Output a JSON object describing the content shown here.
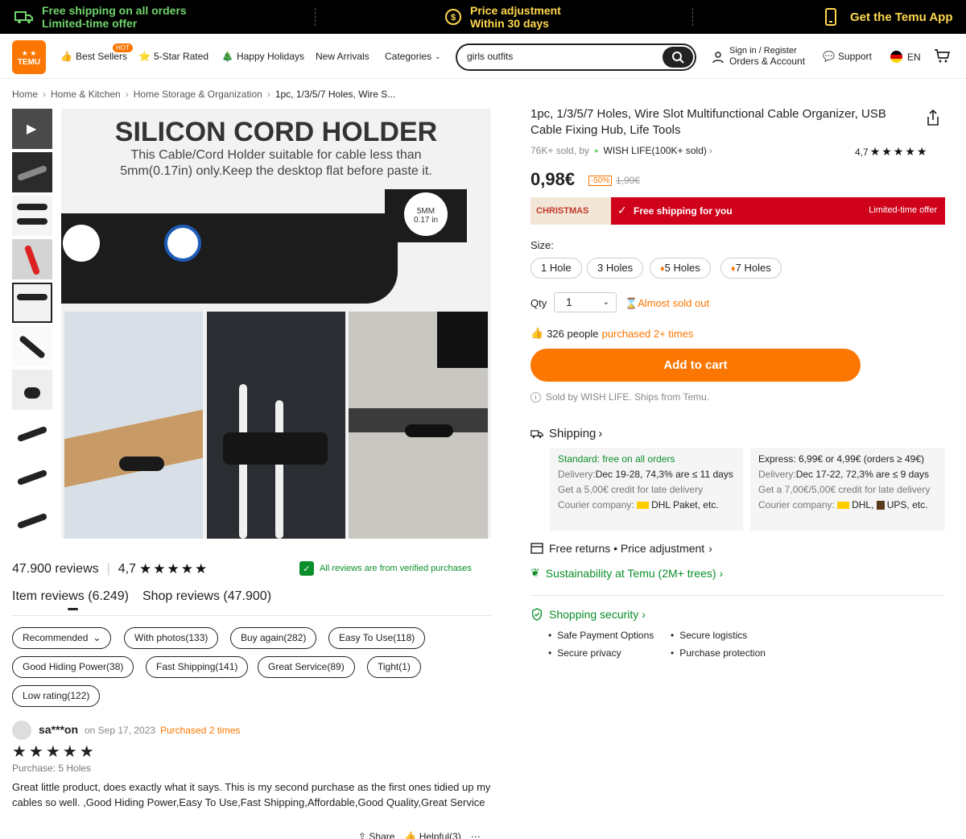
{
  "promo": {
    "shipping_line1": "Free shipping on all orders",
    "shipping_line2": "Limited-time offer",
    "price_line1": "Price adjustment",
    "price_line2": "Within 30 days",
    "app": "Get the Temu App"
  },
  "header": {
    "logo_text": "TEMU",
    "nav": [
      "Best Sellers",
      "5-Star Rated",
      "Happy Holidays",
      "New Arrivals",
      "Categories"
    ],
    "hot_badge": "HOT",
    "search_value": "girls outfits",
    "signin": "Sign in / Register",
    "orders": "Orders & Account",
    "support": "Support",
    "language": "EN"
  },
  "breadcrumb": [
    "Home",
    "Home & Kitchen",
    "Home Storage & Organization",
    "1pc, 1/3/5/7 Holes, Wire S..."
  ],
  "gallery": {
    "headline": "SILICON CORD HOLDER",
    "subline1": "This Cable/Cord Holder suitable for cable less than",
    "subline2": "5mm(0.17in) only.Keep the desktop flat before paste it.",
    "inset_1": "5MM",
    "inset_2": "0.17 in",
    "thumb_count": 10
  },
  "reviews": {
    "total": "47.900 reviews",
    "rating": "4,7",
    "verified": "All reviews are from verified purchases",
    "tab_item": "Item reviews (6.249)",
    "tab_shop": "Shop reviews (47.900)",
    "filters": [
      "Recommended",
      "With photos(133)",
      "Buy again(282)",
      "Easy To Use(118)",
      "Good Hiding Power(38)",
      "Fast Shipping(141)",
      "Great Service(89)",
      "Tight(1)",
      "Low rating(122)"
    ],
    "first": {
      "name": "sa***on",
      "date": "on Sep 17, 2023",
      "purchased": "Purchased 2 times",
      "purchase": "Purchase: 5 Holes",
      "text": "Great little product, does exactly what it says. This is my second purchase as the first ones tidied up my cables so well. ,Good Hiding Power,Easy To Use,Fast Shipping,Affordable,Good Quality,Great Service",
      "share": "Share",
      "helpful": "Helpful(3)"
    }
  },
  "product": {
    "title": "1pc, 1/3/5/7 Holes, Wire Slot Multifunctional Cable Organizer, USB Cable Fixing Hub, Life Tools",
    "sold": "76K+ sold, by",
    "store": "WISH LIFE(100K+ sold)",
    "rating": "4,7",
    "price": "0,98€",
    "discount": "-50%",
    "old_price": "1,99€",
    "banner_tag": "CHRISTMAS",
    "banner_text": "Free shipping for you",
    "banner_right": "Limited-time offer",
    "size_label": "Size:",
    "sizes": [
      "1 Hole",
      "3 Holes",
      "5 Holes",
      "7 Holes"
    ],
    "qty_label": "Qty",
    "qty": "1",
    "almost": "Almost sold out",
    "people_a": "326 people",
    "people_b": "purchased 2+ times",
    "cart": "Add to cart",
    "soldby": "Sold by WISH LIFE. Ships from Temu."
  },
  "shipping": {
    "title": "Shipping",
    "std_title": "Standard: free on all orders",
    "std_delivery_label": "Delivery:",
    "std_delivery": "Dec 19-28, 74,3% are ≤ 11 days",
    "std_credit": "Get a 5,00€ credit for late delivery",
    "std_courier_label": "Courier company:",
    "std_courier": "DHL Paket, etc.",
    "exp_title": "Express: 6,99€ or 4,99€ (orders ≥ 49€)",
    "exp_delivery_label": "Delivery:",
    "exp_delivery": "Dec 17-22, 72,3% are ≤ 9 days",
    "exp_credit": "Get a 7,00€/5,00€ credit for late delivery",
    "exp_courier_label": "Courier company:",
    "exp_courier_a": "DHL,",
    "exp_courier_b": "UPS, etc."
  },
  "services": {
    "returns": "Free returns • Price adjustment",
    "sustain": "Sustainability at Temu (2M+ trees)",
    "security": "Shopping security",
    "items": [
      "Safe Payment Options",
      "Secure logistics",
      "Secure privacy",
      "Purchase protection"
    ]
  },
  "colors": {
    "accent": "#fb7701",
    "green": "#0a8f2a",
    "banner": "#d0021b"
  }
}
